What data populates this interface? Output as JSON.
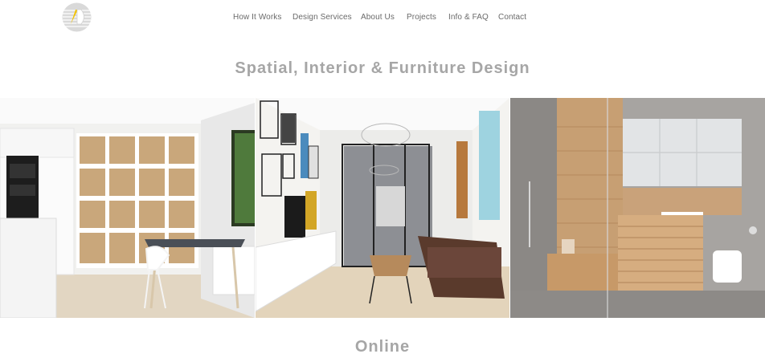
{
  "brand": {
    "logo_icon": "ad-monogram-logo-icon",
    "logo_text": "AD"
  },
  "nav": {
    "items": [
      {
        "label": "How It Works"
      },
      {
        "label": "Design Services"
      },
      {
        "label": "About Us"
      },
      {
        "label": "Projects"
      },
      {
        "label": "Info & FAQ"
      },
      {
        "label": "Contact"
      }
    ]
  },
  "hero": {
    "title": "Spatial, Interior & Furniture Design"
  },
  "gallery": {
    "panels": [
      {
        "icon": "kitchen-dining-render-image"
      },
      {
        "icon": "living-room-render-image"
      },
      {
        "icon": "bathroom-render-image"
      }
    ]
  },
  "section": {
    "title": "Online"
  },
  "colors": {
    "heading": "#a6a6a6",
    "nav_text": "#6a6a6a",
    "background": "#ffffff"
  }
}
